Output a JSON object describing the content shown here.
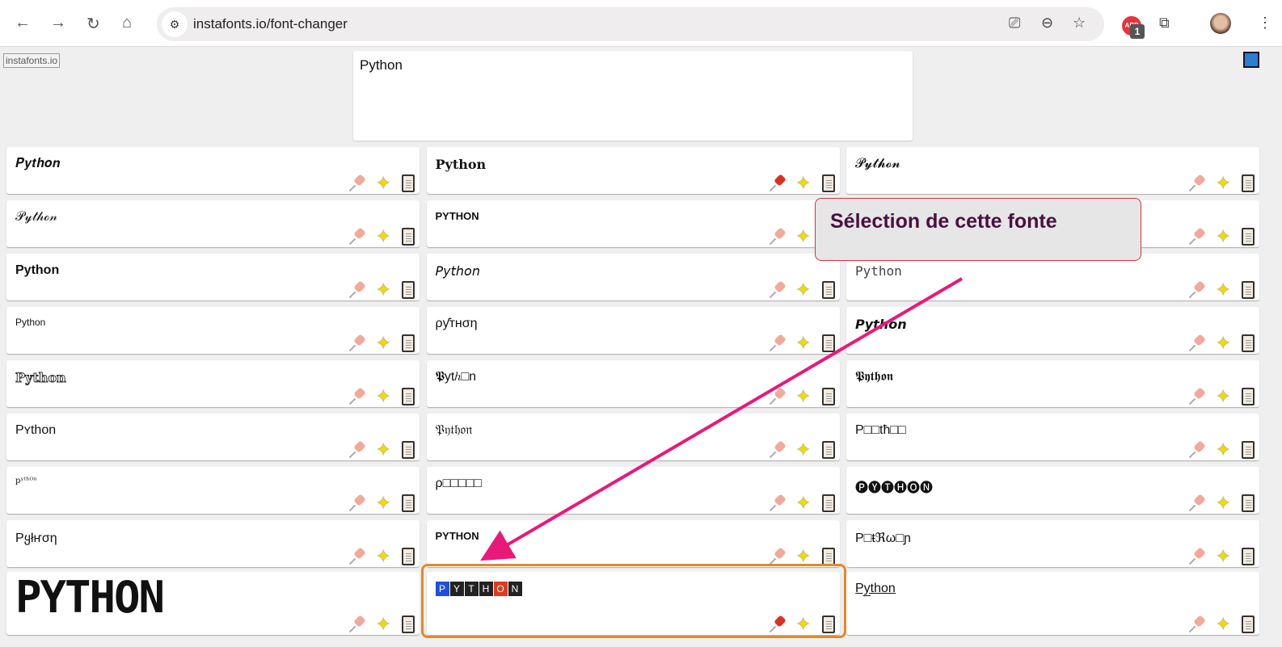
{
  "browser": {
    "url": "instafonts.io/font-changer",
    "abp_badge": "1",
    "abp_label": "ABP"
  },
  "page": {
    "brand": "instafonts.io",
    "input_value": "Python"
  },
  "callout": {
    "text": "Sélection de cette fonte"
  },
  "colors": {
    "arrow": "#e8197a",
    "highlight": "#e08a2a",
    "pinned": "#d8321f"
  },
  "cards": [
    {
      "text": "𝑷𝒚𝒕𝒉𝒐𝒏",
      "pinned": false
    },
    {
      "text": "Python",
      "pinned": true,
      "style": "bold serif"
    },
    {
      "text": "𝓟𝔂𝓽𝓱𝓸𝓷",
      "pinned": false
    },
    {
      "text": "𝒫𝓎𝓉𝒽ℴ𝓃",
      "pinned": false
    },
    {
      "text": "PYTHON",
      "pinned": false,
      "style": "small bold"
    },
    {
      "text": "",
      "pinned": false
    },
    {
      "text": "Python",
      "pinned": false,
      "style": "bold"
    },
    {
      "text": "𝘗𝘺𝘵𝘩𝘰𝘯",
      "pinned": false
    },
    {
      "text": "Python",
      "pinned": false,
      "style": "mono"
    },
    {
      "text": "Python",
      "pinned": false,
      "style": "small"
    },
    {
      "text": "ρƴтнση",
      "pinned": false
    },
    {
      "text": "𝙋𝙮𝙩𝙝𝙤𝙣",
      "pinned": false
    },
    {
      "text": "Python",
      "pinned": false,
      "style": "outline"
    },
    {
      "text": "𝕻ytℎ□n",
      "pinned": false
    },
    {
      "text": "𝕻𝖞𝖙𝖍𝖔𝖓",
      "pinned": false
    },
    {
      "text": "Pʏthon",
      "pinned": false
    },
    {
      "text": "𝔓𝔶𝔱𝔥𝔬𝔫",
      "pinned": false
    },
    {
      "text": "P□□tħ□□",
      "pinned": false
    },
    {
      "text": "pʸᵗʰᴼⁿ",
      "pinned": false,
      "style": "tiny"
    },
    {
      "text": "ρ□□□□□",
      "pinned": false
    },
    {
      "text": "🅟🅨🅣🅗🅞🅝",
      "pinned": false
    },
    {
      "text": "Pყłҥση",
      "pinned": false
    },
    {
      "text": "PYTHON",
      "pinned": false,
      "style": "small bold"
    },
    {
      "text": "P□ŧℜω□ɲ",
      "pinned": false
    },
    {
      "text": "PYTHON",
      "pinned": false,
      "style": "pixel"
    },
    {
      "text": "PYTHON",
      "pinned": true,
      "style": "boxed"
    },
    {
      "text": "P̲y̲t̲h̲o̲n̲",
      "pinned": false
    }
  ]
}
